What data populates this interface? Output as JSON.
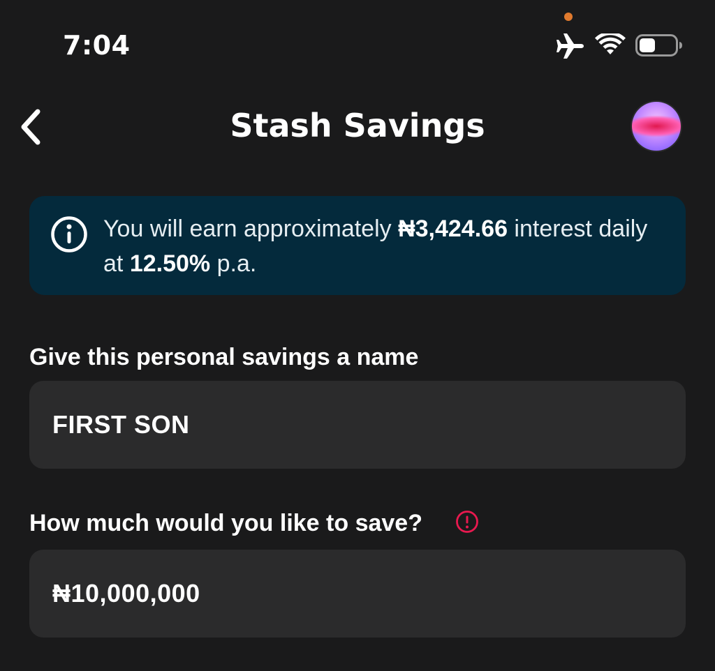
{
  "status_bar": {
    "time": "7:04",
    "privacy_dot_color": "#e07a2e",
    "icons": [
      "airplane-icon",
      "wifi-icon",
      "battery-icon"
    ]
  },
  "header": {
    "back_icon": "chevron-left-icon",
    "title": "Stash Savings",
    "avatar": "avatar"
  },
  "info_banner": {
    "icon": "info-icon",
    "text_before_amount": "You will earn approximately ",
    "amount": "₦3,424.66",
    "text_after_amount": " interest daily at ",
    "rate": "12.50%",
    "text_end": " p.a.",
    "background_color": "#042a3c"
  },
  "form": {
    "name_label": "Give this personal savings a name",
    "name_value": "FIRST SON",
    "amount_label": "How much would you like to save?",
    "amount_warning_icon": "alert-circle-icon",
    "amount_warning_color": "#e8194f",
    "amount_value": "₦10,000,000"
  }
}
